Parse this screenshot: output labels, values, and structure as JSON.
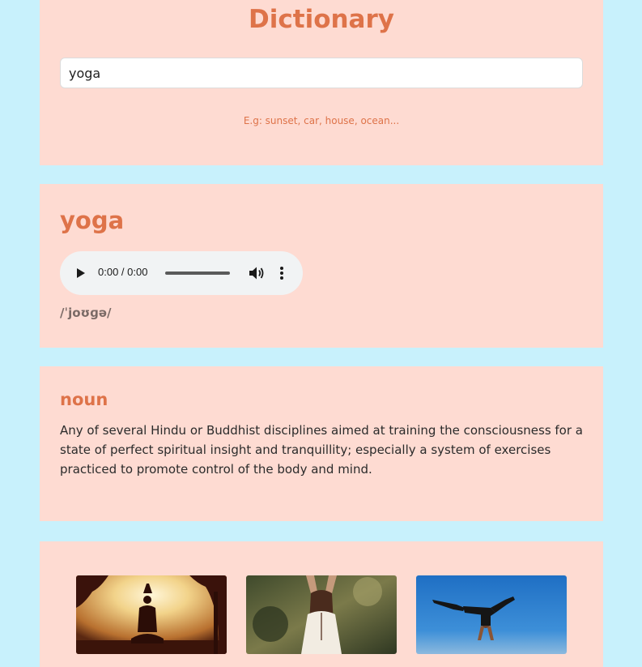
{
  "header": {
    "title": "Dictionary"
  },
  "search": {
    "value": "yoga",
    "hint": "E.g: sunset, car, house, ocean..."
  },
  "word": {
    "text": "yoga",
    "phonetic": "/ˈjoʊɡə/"
  },
  "audio_player": {
    "time": "0:00 / 0:00",
    "progress": 0,
    "icons": [
      "play-icon",
      "volume-icon",
      "more-options-icon"
    ]
  },
  "meaning": {
    "part_of_speech": "noun",
    "definition": "Any of several Hindu or Buddhist disciplines aimed at training the consciousness for a state of perfect spiritual insight and tranquillity; especially a system of exercises practiced to promote control of the body and mind."
  },
  "photos": {
    "count_visible": 3
  },
  "colors": {
    "page_background": "#c8f1fc",
    "card_background": "#fedbd2",
    "accent": "#de7349",
    "text": "#2b2b2b"
  }
}
